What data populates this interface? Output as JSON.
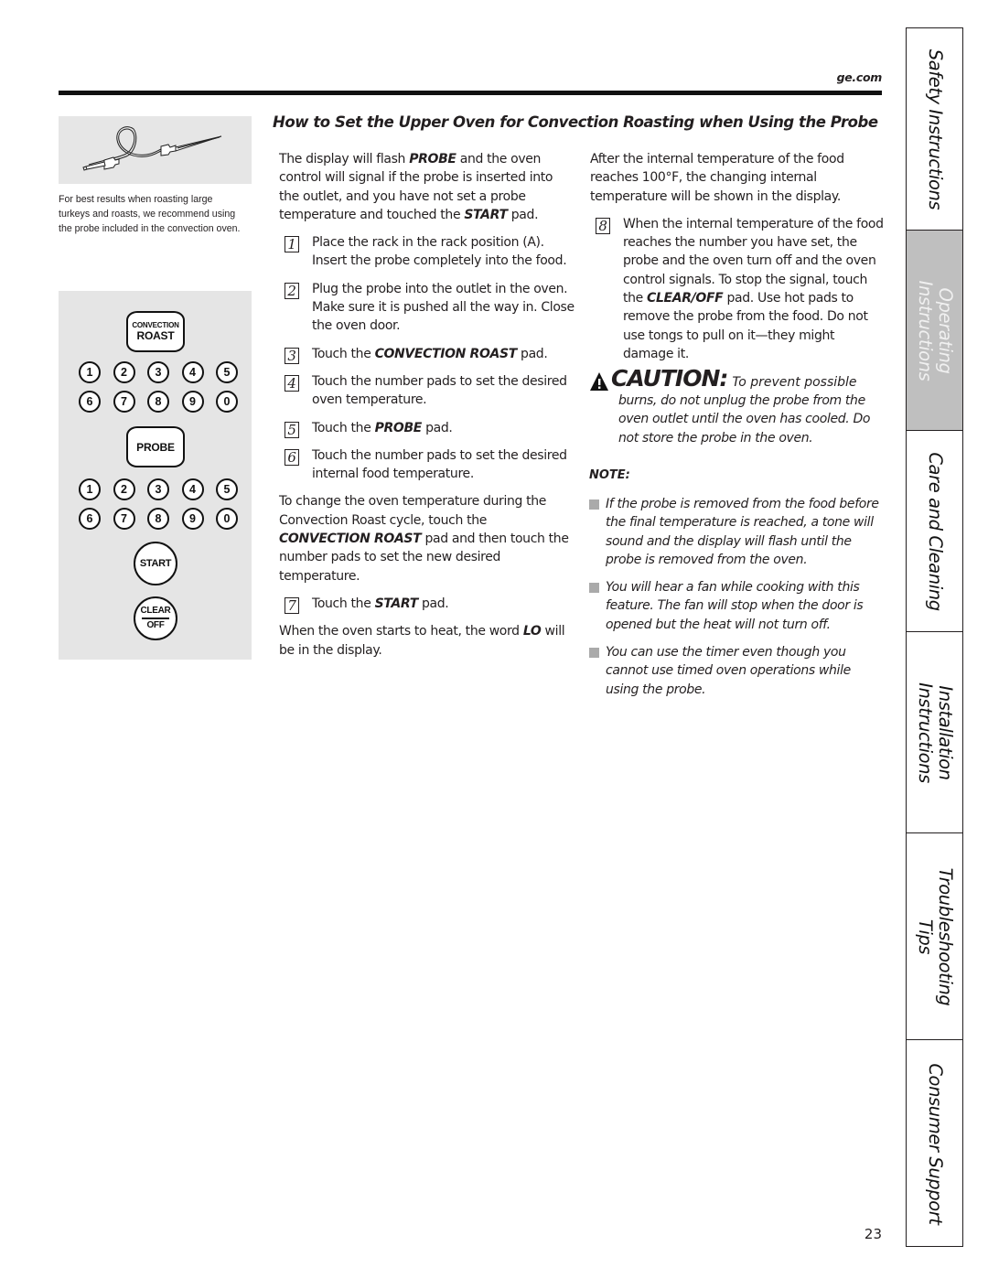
{
  "header": {
    "site": "ge.com"
  },
  "title": "How to Set the Upper Oven for Convection Roasting when Using the Probe",
  "sidebar": {
    "probe_caption": "For best results when roasting large turkeys and roasts, we recommend using the probe included in the convection oven.",
    "control_panel": {
      "convection_roast": {
        "line1": "Convection",
        "line2": "Roast"
      },
      "number_pads_row1": [
        "1",
        "2",
        "3",
        "4",
        "5"
      ],
      "number_pads_row2": [
        "6",
        "7",
        "8",
        "9",
        "0"
      ],
      "probe": "Probe",
      "start": "Start",
      "clear": "Clear",
      "off": "Off"
    }
  },
  "column1": {
    "intro": [
      {
        "t": "The display will flash "
      },
      {
        "b": "PROBE"
      },
      {
        "t": " and the oven control will signal if the probe is inserted into the outlet, and you have not set a probe temperature and touched the "
      },
      {
        "b": "START"
      },
      {
        "t": " pad."
      }
    ],
    "steps_a": [
      {
        "num": "1",
        "text": [
          {
            "t": "Place the rack in the rack position (A). Insert the probe completely into the food."
          }
        ]
      },
      {
        "num": "2",
        "text": [
          {
            "t": "Plug the probe into the outlet in the oven. Make sure it is pushed all the way in. Close the oven door."
          }
        ]
      },
      {
        "num": "3",
        "text": [
          {
            "t": "Touch the "
          },
          {
            "b": "CONVECTION ROAST"
          },
          {
            "t": " pad."
          }
        ]
      },
      {
        "num": "4",
        "text": [
          {
            "t": "Touch the number pads to set the desired oven temperature."
          }
        ]
      },
      {
        "num": "5",
        "text": [
          {
            "t": "Touch the "
          },
          {
            "b": "PROBE"
          },
          {
            "t": " pad."
          }
        ]
      },
      {
        "num": "6",
        "text": [
          {
            "t": "Touch the number pads to set the desired internal food temperature."
          }
        ]
      }
    ],
    "change_temp": [
      {
        "t": "To change the oven temperature during the Convection Roast cycle, touch the "
      },
      {
        "b": "CONVECTION ROAST"
      },
      {
        "t": " pad and then touch the number pads to set the new desired temperature."
      }
    ],
    "steps_b": [
      {
        "num": "7",
        "text": [
          {
            "t": "Touch the "
          },
          {
            "b": "START"
          },
          {
            "t": " pad."
          }
        ]
      }
    ],
    "heating_note": [
      {
        "t": "When the oven starts to heat, the word "
      },
      {
        "b": "LO"
      },
      {
        "t": " will be in the display."
      }
    ]
  },
  "column2": {
    "intro": "After the internal temperature of the food reaches 100°F, the changing internal temperature will be shown in the display.",
    "steps": [
      {
        "num": "8",
        "text": [
          {
            "t": "When the internal temperature of the food reaches the number you have set, the probe and the oven turn off and the oven control signals. To stop the signal, touch the "
          },
          {
            "b": "CLEAR/OFF"
          },
          {
            "t": " pad. Use hot pads to remove the probe from the food. Do not use tongs to pull on it—they might damage it."
          }
        ]
      }
    ],
    "caution": {
      "label": "CAUTION:",
      "first": "To prevent possible",
      "rest": "burns, do not unplug the probe from the oven outlet until the oven has cooled. Do not store the probe in the oven."
    },
    "note_label": "NOTE:",
    "notes": [
      "If the probe is removed from the food before the final temperature is reached, a tone will sound and the display will flash until the probe is removed from the oven.",
      "You will hear a fan while cooking with this feature. The fan will stop when the door is opened but the heat will not turn off.",
      "You can use the timer even though you cannot use timed oven operations while using the probe."
    ]
  },
  "tabs": [
    {
      "lines": [
        "Safety Instructions"
      ],
      "active": false
    },
    {
      "lines": [
        "Operating",
        "Instructions"
      ],
      "active": true
    },
    {
      "lines": [
        "Care and Cleaning"
      ],
      "active": false
    },
    {
      "lines": [
        "Installation",
        "Instructions"
      ],
      "active": false
    },
    {
      "lines": [
        "Troubleshooting",
        "Tips"
      ],
      "active": false
    },
    {
      "lines": [
        "Consumer Support"
      ],
      "active": false
    }
  ],
  "colors": {
    "active_tab": "#bfbfbf",
    "panel_bg": "#e5e5e5",
    "bullet": "#aaaaaa"
  },
  "page_number": "23"
}
